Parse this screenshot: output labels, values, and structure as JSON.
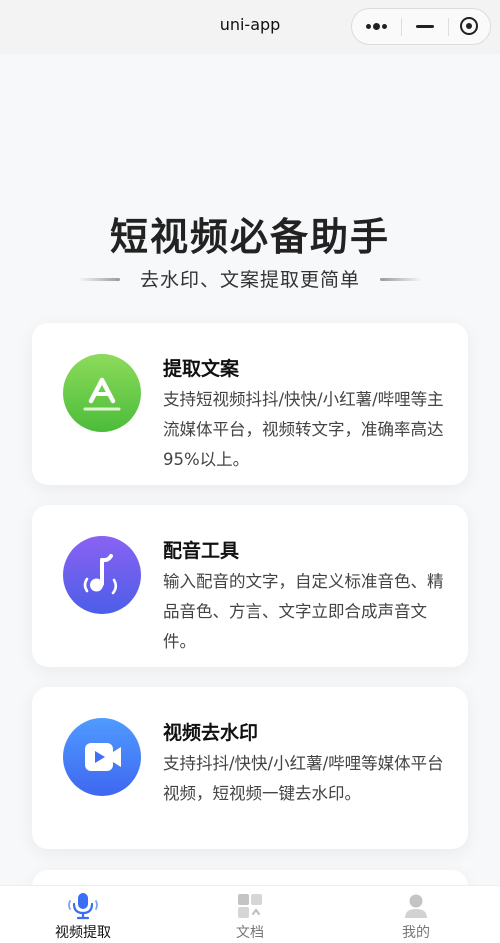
{
  "navbar": {
    "title": "uni-app",
    "capsule": {
      "more_icon": "more-dots-icon",
      "minimize_icon": "minimize-icon",
      "close_icon": "close-target-icon"
    }
  },
  "hero": {
    "title": "短视频必备助手",
    "subtitle": "去水印、文案提取更简单"
  },
  "cards": [
    {
      "title": "提取文案",
      "description": "支持短视频抖抖/快快/小红薯/哔哩等主流媒体平台，视频转文字，准确率高达95%以上。",
      "icon": "app-store-a-icon",
      "color": "#5bc443"
    },
    {
      "title": "配音工具",
      "description": "输入配音的文字，自定义标准音色、精品音色、方言、文字立即合成声音文件。",
      "icon": "music-note-icon",
      "color": "#6a5cf0"
    },
    {
      "title": "视频去水印",
      "description": "支持抖抖/快快/小红薯/哔哩等媒体平台视频，短视频一键去水印。",
      "icon": "video-play-icon",
      "color": "#4a86fb"
    }
  ],
  "tabbar": {
    "items": [
      {
        "label": "视频提取",
        "icon": "microphone-icon",
        "active": true
      },
      {
        "label": "文档",
        "icon": "document-grid-icon",
        "active": false
      },
      {
        "label": "我的",
        "icon": "user-icon",
        "active": false
      }
    ],
    "active_color": "#3b6df5",
    "inactive_color": "#bbbbbb"
  }
}
